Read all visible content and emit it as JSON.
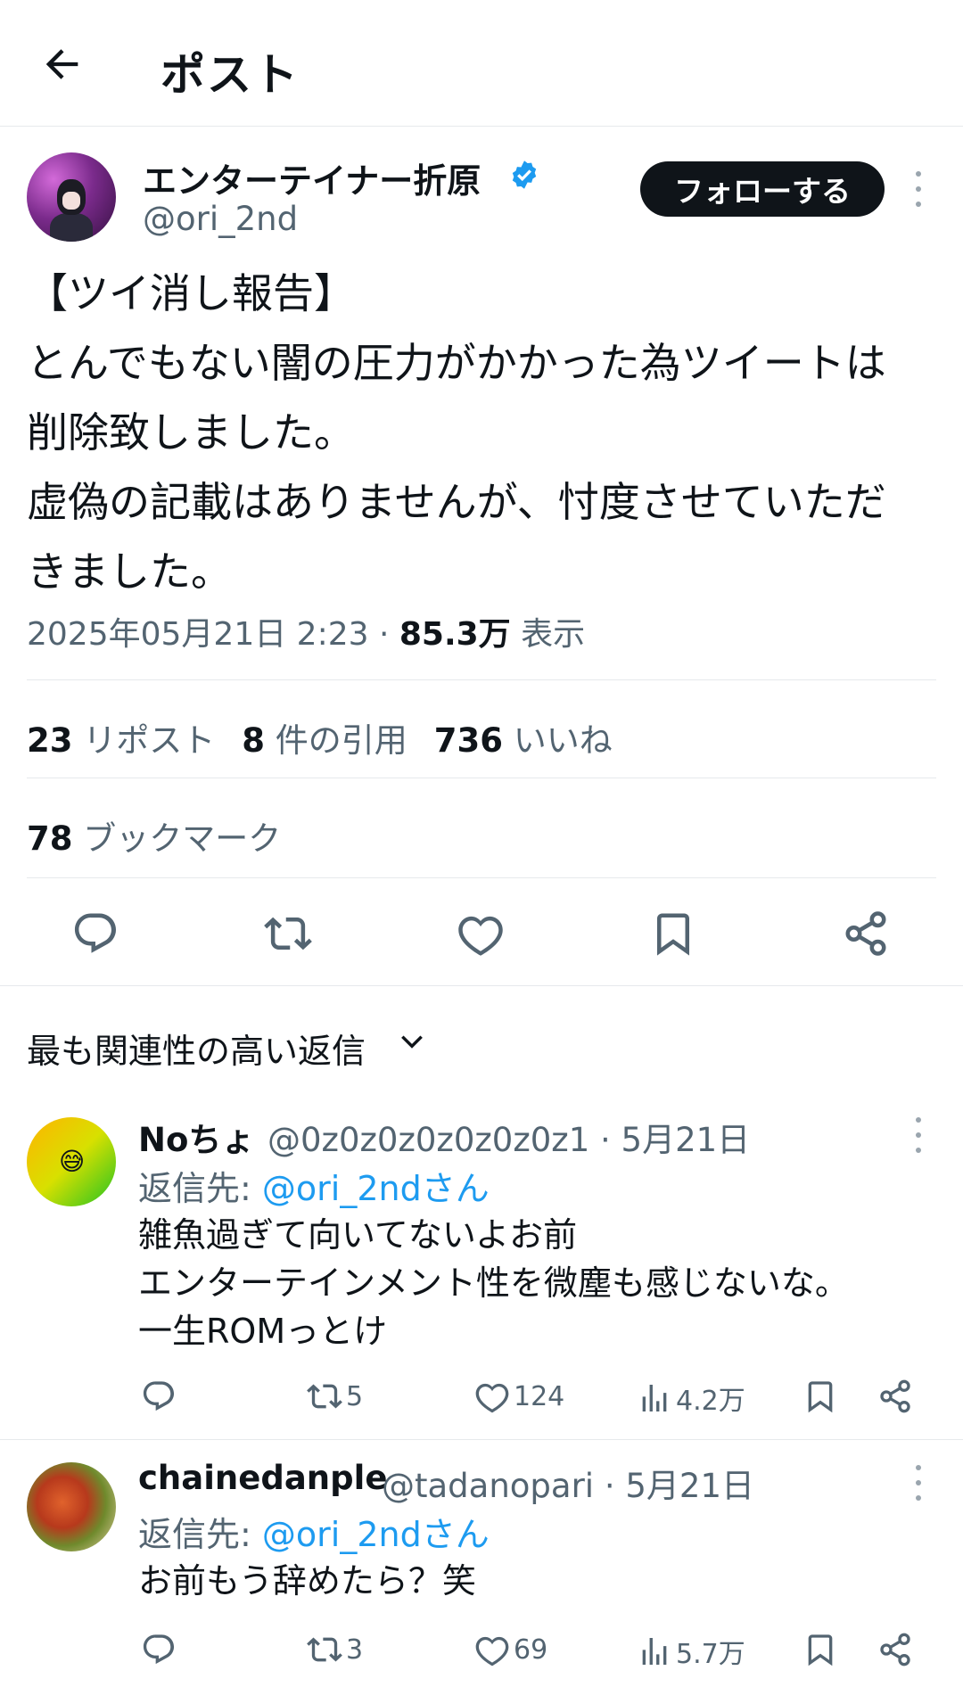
{
  "header": {
    "title": "ポスト",
    "back_icon": "arrow-left-icon"
  },
  "post": {
    "author_name": "エンターテイナー折原",
    "author_handle": "@ori_2nd",
    "verified_color": "#1d9bf0",
    "follow_label": "フォローする",
    "text": "【ツイ消し報告】\nとんでもない闇の圧力がかかった為ツイートは\n削除致しました。\n虚偽の記載はありませんが、忖度させていただ\nきました。",
    "date": "2025年05月21日 2:23 · ",
    "views_count": "85.3万",
    "views_label": "表示",
    "reposts_count": "23",
    "reposts_label": "リポスト",
    "quotes_count": "8",
    "quotes_label": "件の引用",
    "likes_count": "736",
    "likes_label": "いいね",
    "bookmarks_count": "78",
    "bookmarks_label": "ブックマーク"
  },
  "sort": {
    "label": "最も関連性の高い返信"
  },
  "replies": [
    {
      "name": "Noちょ",
      "handle": "@0z0z0z0z0z0z0z1 · 5月21日",
      "reply_prefix": "返信先: ",
      "reply_target": "@ori_2ndさん",
      "text": "雑魚過ぎて向いてないよお前\nエンターテインメント性を微塵も感じないな。\n一生ROMっとけ",
      "avatar_emoji": "😅",
      "reposts": "5",
      "likes": "124",
      "views": "4.2万"
    },
    {
      "name": "chainedanple",
      "handle": "@tadanopari · 5月21日",
      "reply_prefix": "返信先: ",
      "reply_target": "@ori_2ndさん",
      "text": "お前もう辞めたら？笑",
      "reposts": "3",
      "likes": "69",
      "views": "5.7万"
    }
  ],
  "colors": {
    "text": "#0f1419",
    "secondary": "#536471",
    "link": "#1d9bf0",
    "divider": "#e6e9ec"
  }
}
